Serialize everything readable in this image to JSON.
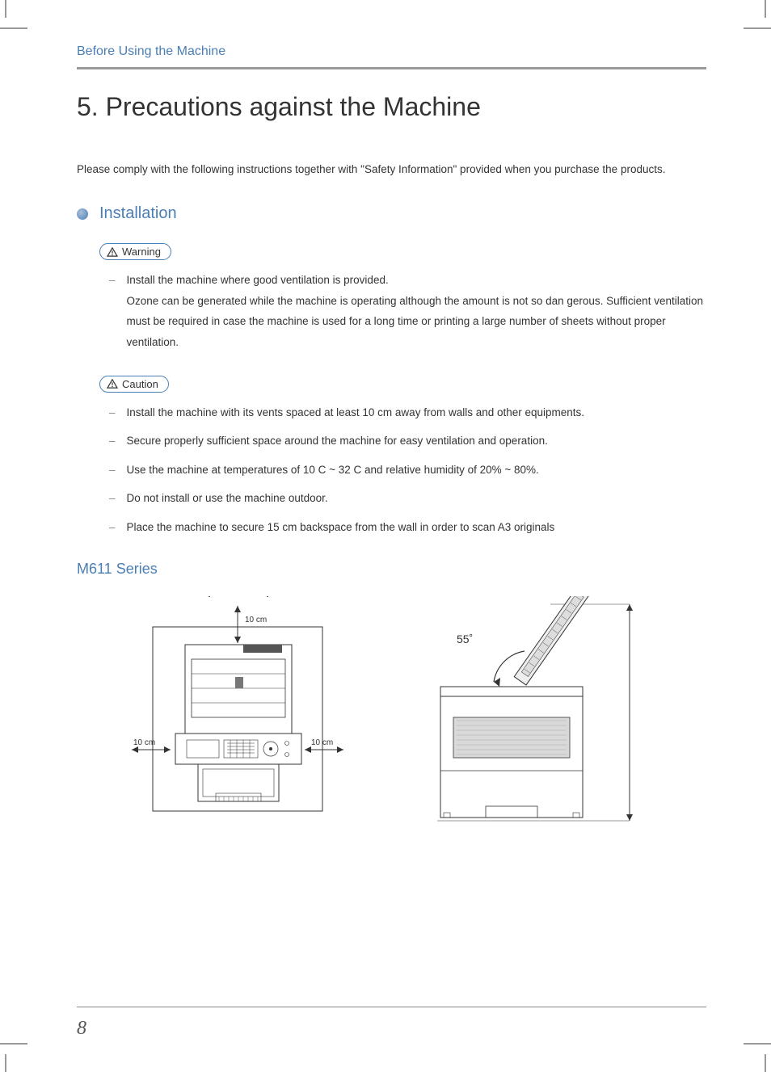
{
  "header": {
    "section": "Before Using the Machine"
  },
  "title": {
    "number": "5.",
    "text": "Precautions against the Machine"
  },
  "intro": "Please comply with the following instructions together with \"Safety Information\" provided when you purchase the products.",
  "section1": {
    "heading": "Installation"
  },
  "warning_label": "Warning",
  "caution_label": "Caution",
  "warning_items": [
    "Install the machine where good ventilation is provided.\nOzone can be generated while the machine is operating although the amount is not so dan gerous. Sufficient ventilation must be required in case the machine is used for a long time or printing a large number of sheets without proper ventilation."
  ],
  "caution_items": [
    "Install the machine with its vents spaced at least 10 cm away from walls and other equipments.",
    "Secure properly sufficient space around the machine for easy ventilation and operation.",
    "Use the machine at temperatures of 10 C ~ 32 C and relative humidity of 20% ~ 80%.",
    "Do not install or use the machine outdoor.",
    "Place the machine to secure 15 cm backspace from the wall in order to scan A3 originals"
  ],
  "sub_heading": "M611 Series",
  "diagram": {
    "top_label": "10 cm",
    "left_label": "10 cm",
    "right_label": "10 cm",
    "angle_label": "55˚"
  },
  "page_number": "8"
}
